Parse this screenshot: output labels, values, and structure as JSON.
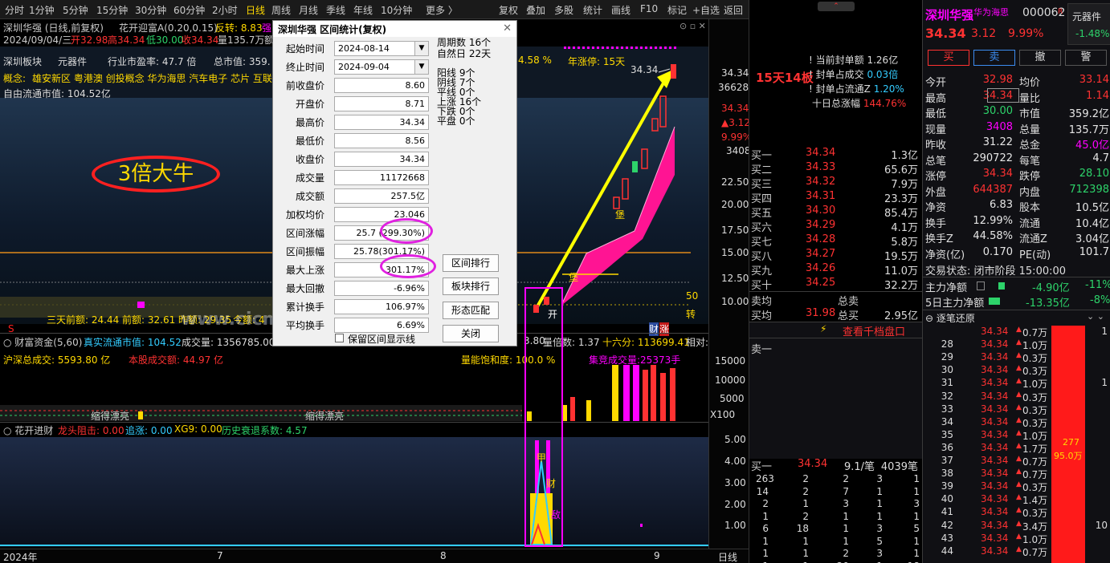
{
  "toolbar": {
    "periods": [
      "分时",
      "1分钟",
      "5分钟",
      "15分钟",
      "30分钟",
      "60分钟",
      "2小时",
      "日线",
      "周线",
      "月线",
      "季线",
      "年线",
      "10分钟",
      "更多 〉"
    ],
    "active": "日线",
    "actions": [
      "复权",
      "叠加",
      "多股",
      "统计",
      "画线",
      "F10",
      "标记",
      "+自选",
      "返回"
    ]
  },
  "chart_header": {
    "line1": "深圳华强 (日线,前复权)",
    "indicator": "花开迎富A(0.20,0.15)",
    "fanzhuan": "反转: 8.83",
    "qiang": "强",
    "line2_date": "2024/09/04/三",
    "open": "开32.98",
    "high": "高34.34",
    "low": "低30.00",
    "close": "收34.34",
    "amount": "量135.7万",
    "suffix": "额"
  },
  "info_bar": {
    "board": "深圳板块",
    "sector": "元器件",
    "pe": "行业市盈率:  47.7 倍",
    "mcap": "总市值:  359.",
    "concept_label": "概念:",
    "concepts": "雄安新区 粤港澳 创投概念 华为海思 汽车电子 芯片 互联",
    "float_mcap": "自由流通市值:  104.52亿",
    "pct": "4.58 %",
    "limit_days": "年涨停: 15天"
  },
  "annotation": {
    "big_label": "3倍大牛"
  },
  "price_axis": {
    "labels": [
      "34.34",
      "36628",
      "34.34",
      "▲3.12",
      "9.99%",
      "3408",
      "22.50",
      "20.00",
      "17.50",
      "15.00",
      "12.50",
      "10.00"
    ],
    "marker_50": "50",
    "marker_zhuan": "转",
    "peak_label": "34.34"
  },
  "main_chart_markers": {
    "bao1": "堡",
    "bao2": "堡",
    "kai": "开",
    "cai": "财",
    "zhang": "涨"
  },
  "bottom_main": {
    "three_day": "三天前额: 24.44",
    "prev_amt": "前额: 32.61",
    "yesterday": "昨额: 29.35",
    "today": "今额: 4"
  },
  "volume_header": {
    "title": "财富资金(5,60)",
    "float_mv": "真实流通市值: 104.52",
    "vol": "成交量: 1356785.00",
    "suffix1": "3.80",
    "liang": "量倍数: 1.37",
    "sixteen": "十六分: 113699.41",
    "rel": "相对:"
  },
  "volume_sub": {
    "hs": "沪深总成交:  5593.80 亿",
    "this_stock": "本股成交额:  44.97 亿",
    "saturation": "量能饱和度:  100.0 %",
    "bid_amt": "集竞成交量:25373手",
    "axis": [
      "15000",
      "10000",
      "5000",
      "X100"
    ],
    "tag1": "缩得漂亮",
    "tag2": "缩得漂亮"
  },
  "bottom_panel": {
    "title": "花开进财",
    "dragon": "龙头阻击: 0.00",
    "chase": "追涨: 0.00",
    "xg9": "XG9: 0.00",
    "history": "历史衰退系数: 4.57",
    "axis": [
      "5.00",
      "4.00",
      "3.00",
      "2.00",
      "1.00"
    ],
    "tag_jia": "甲",
    "tag_cai": "财",
    "tag_di": "敌"
  },
  "time_axis": {
    "labels": [
      "2024年",
      "7",
      "8",
      "9"
    ],
    "period": "日线"
  },
  "dialog": {
    "title": "深圳华强  区间统计(复权)",
    "fields": [
      {
        "label": "起始时间",
        "value": "2024-08-14"
      },
      {
        "label": "终止时间",
        "value": "2024-09-04"
      },
      {
        "label": "前收盘价",
        "value": "8.60"
      },
      {
        "label": "开盘价",
        "value": "8.71"
      },
      {
        "label": "最高价",
        "value": "34.34"
      },
      {
        "label": "最低价",
        "value": "8.56"
      },
      {
        "label": "收盘价",
        "value": "34.34"
      },
      {
        "label": "成交量",
        "value": "11172668"
      },
      {
        "label": "成交额",
        "value": "257.5亿"
      },
      {
        "label": "加权均价",
        "value": "23.046"
      },
      {
        "label": "区间涨幅",
        "value": "25.7  (299.30%)"
      },
      {
        "label": "区间振幅",
        "value": "25.78(301.17%)"
      },
      {
        "label": "最大上涨",
        "value": "301.17%"
      },
      {
        "label": "最大回撤",
        "value": "-6.96%"
      },
      {
        "label": "累计换手",
        "value": "106.97%"
      },
      {
        "label": "平均换手",
        "value": "6.69%"
      }
    ],
    "stats": [
      "周期数  16个",
      "自然日  22天",
      "阳线  9个",
      "阴线  7个",
      "平线  0个",
      "上涨  16个",
      "下跌  0个",
      "平盘  0个"
    ],
    "buttons": [
      "区间排行",
      "板块排行",
      "形态匹配",
      "关闭"
    ],
    "checkbox": "保留区间显示线"
  },
  "watermark": "www.cicmi.com",
  "stock": {
    "name": "深圳华强",
    "tag": "华为海思",
    "code": "000062",
    "flag": "R",
    "sector": "元器件",
    "sector_chg": "-1.48%",
    "price": "34.34",
    "chg": "3.12",
    "pct": "9.99%"
  },
  "trade_buttons": [
    "买",
    "卖",
    "撤",
    "警"
  ],
  "limit_box": {
    "streak": "15天14板",
    "lines": [
      {
        "label": "当前封单额",
        "value": "1.26亿"
      },
      {
        "label": "封单占成交",
        "value": "0.03倍"
      },
      {
        "label": "封单占流通Z",
        "value": "1.20%"
      },
      {
        "label": "十日总涨幅",
        "value": "144.76%"
      }
    ]
  },
  "buy_levels": [
    {
      "label": "买一",
      "price": "34.34",
      "vol": "1.3亿"
    },
    {
      "label": "买二",
      "price": "34.33",
      "vol": "65.6万"
    },
    {
      "label": "买三",
      "price": "34.32",
      "vol": "7.9万"
    },
    {
      "label": "买四",
      "price": "34.31",
      "vol": "23.3万"
    },
    {
      "label": "买五",
      "price": "34.30",
      "vol": "85.4万"
    },
    {
      "label": "买六",
      "price": "34.29",
      "vol": "4.1万"
    },
    {
      "label": "买七",
      "price": "34.28",
      "vol": "5.8万"
    },
    {
      "label": "买八",
      "price": "34.27",
      "vol": "19.5万"
    },
    {
      "label": "买九",
      "price": "34.26",
      "vol": "11.0万"
    },
    {
      "label": "买十",
      "price": "34.25",
      "vol": "32.2万"
    }
  ],
  "avg_rows": [
    {
      "label": "卖均",
      "price": "",
      "label2": "总卖",
      "vol": ""
    },
    {
      "label": "买均",
      "price": "31.98",
      "label2": "总买",
      "vol": "2.95亿"
    }
  ],
  "check_book": "查看千档盘口",
  "sell_label": "卖一",
  "buy_one": {
    "label": "买一",
    "price": "34.34",
    "avg": "9.1/笔",
    "count": "4039笔"
  },
  "queue_rows": [
    [
      "263",
      "2",
      "2",
      "3",
      "1"
    ],
    [
      "14",
      "2",
      "7",
      "1",
      "1"
    ],
    [
      "2",
      "1",
      "3",
      "1",
      "3"
    ],
    [
      "1",
      "2",
      "1",
      "1",
      "1"
    ],
    [
      "6",
      "18",
      "1",
      "3",
      "5"
    ],
    [
      "1",
      "1",
      "1",
      "5",
      "1"
    ],
    [
      "1",
      "1",
      "2",
      "3",
      "1"
    ],
    [
      "1",
      "1",
      "20",
      "1",
      "18"
    ]
  ],
  "quote": [
    {
      "l": "今开",
      "v": "32.98",
      "c": "red",
      "l2": "均价",
      "v2": "33.14",
      "c2": "red"
    },
    {
      "l": "最高",
      "v": "34.34",
      "c": "red",
      "l2": "量比",
      "v2": "1.14",
      "c2": "red"
    },
    {
      "l": "最低",
      "v": "30.00",
      "c": "green",
      "l2": "市值",
      "v2": "359.2亿",
      "c2": "white"
    },
    {
      "l": "现量",
      "v": "3408",
      "c": "magenta",
      "l2": "总量",
      "v2": "135.7万",
      "c2": "white"
    },
    {
      "l": "昨收",
      "v": "31.22",
      "c": "white",
      "l2": "总金",
      "v2": "45.0亿",
      "c2": "magenta"
    },
    {
      "l": "总笔",
      "v": "290722",
      "c": "white",
      "l2": "每笔",
      "v2": "4.7",
      "c2": "white"
    },
    {
      "l": "涨停",
      "v": "34.34",
      "c": "red",
      "l2": "跌停",
      "v2": "28.10",
      "c2": "green"
    },
    {
      "l": "外盘",
      "v": "644387",
      "c": "red",
      "l2": "内盘",
      "v2": "712398",
      "c2": "green"
    },
    {
      "l": "净资",
      "v": "6.83",
      "c": "white",
      "l2": "股本",
      "v2": "10.5亿",
      "c2": "white"
    },
    {
      "l": "换手",
      "v": "12.99%",
      "c": "white",
      "l2": "流通",
      "v2": "10.4亿",
      "c2": "white"
    },
    {
      "l": "换手Z",
      "v": "44.58%",
      "c": "white",
      "l2": "流通Z",
      "v2": "3.04亿",
      "c2": "white"
    },
    {
      "l": "净资(亿)",
      "v": "0.170",
      "c": "white",
      "l2": "PE(动)",
      "v2": "101.7",
      "c2": "white"
    }
  ],
  "trade_status": "交易状态: 闭市阶段 15:00:00",
  "fund_flow": [
    {
      "label": "主力净额",
      "v": "-4.90亿",
      "p": "-11%"
    },
    {
      "label": "5日主力净额",
      "v": "-13.35亿",
      "p": "-8%"
    }
  ],
  "tick_title": "逐笔还原",
  "ticks": [
    {
      "n": "",
      "p": "34.34",
      "v": "0.7万",
      "c": "1"
    },
    {
      "n": "28",
      "p": "34.34",
      "v": "1.0万",
      "c": ""
    },
    {
      "n": "29",
      "p": "34.34",
      "v": "0.3万",
      "c": ""
    },
    {
      "n": "30",
      "p": "34.34",
      "v": "0.3万",
      "c": ""
    },
    {
      "n": "31",
      "p": "34.34",
      "v": "1.0万",
      "c": "1"
    },
    {
      "n": "32",
      "p": "34.34",
      "v": "0.3万",
      "c": ""
    },
    {
      "n": "33",
      "p": "34.34",
      "v": "0.3万",
      "c": ""
    },
    {
      "n": "34",
      "p": "34.34",
      "v": "0.3万",
      "c": ""
    },
    {
      "n": "35",
      "p": "34.34",
      "v": "1.0万",
      "c": ""
    },
    {
      "n": "36",
      "p": "34.34",
      "v": "1.7万",
      "c": ""
    },
    {
      "n": "37",
      "p": "34.34",
      "v": "0.7万",
      "c": ""
    },
    {
      "n": "38",
      "p": "34.34",
      "v": "0.7万",
      "c": ""
    },
    {
      "n": "39",
      "p": "34.34",
      "v": "0.3万",
      "c": ""
    },
    {
      "n": "40",
      "p": "34.34",
      "v": "1.4万",
      "c": ""
    },
    {
      "n": "41",
      "p": "34.34",
      "v": "0.3万",
      "c": ""
    },
    {
      "n": "42",
      "p": "34.34",
      "v": "3.4万",
      "c": "10"
    },
    {
      "n": "43",
      "p": "34.34",
      "v": "1.0万",
      "c": ""
    },
    {
      "n": "44",
      "p": "34.34",
      "v": "0.7万",
      "c": ""
    }
  ],
  "tick_bar": {
    "count": "277",
    "vol": "95.0万"
  },
  "colors": {
    "red": "#ff3232",
    "green": "#2dd36a",
    "yellow": "#ffd900",
    "magenta": "#ff00ff",
    "cyan": "#3cf",
    "white": "#e6e6e6",
    "pink": "#ff1493"
  }
}
